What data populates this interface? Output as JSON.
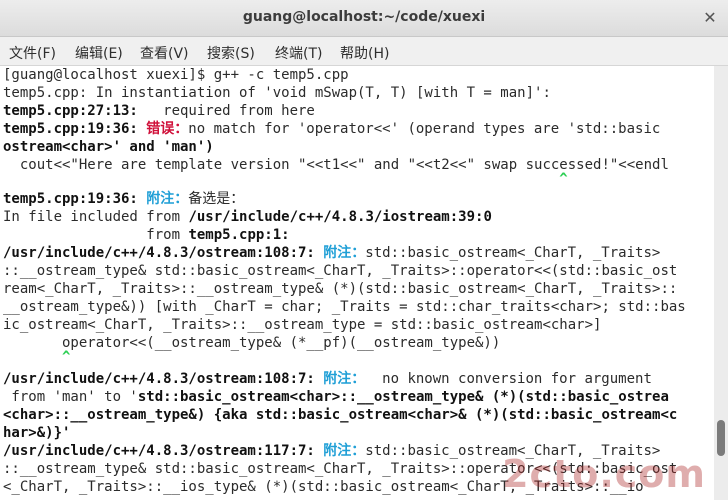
{
  "window": {
    "title": "guang@localhost:~/code/xuexi"
  },
  "menubar": {
    "items": [
      "文件(F)",
      "编辑(E)",
      "查看(V)",
      "搜索(S)",
      "终端(T)",
      "帮助(H)"
    ]
  },
  "terminal": {
    "prompt": "[guang@localhost xuexi]$ g++ -c temp5.cpp",
    "l2": "temp5.cpp: In instantiation of 'void mSwap(T, T) [with T = man]':",
    "l3a": "temp5.cpp:27:13:",
    "l3b": "   required from here",
    "l4a": "temp5.cpp:19:36: ",
    "l4err": "错误：",
    "l4b": "no match for 'operator<<' (operand types are 'std::basic",
    "l5": "ostream<char>' and 'man')",
    "l6": "  cout<<\"Here are template version \"<<t1<<\" and \"<<t2<<\" swap successed!\"<<endl",
    "l7": "                                                                  ^",
    "l8a": "temp5.cpp:19:36: ",
    "l8note": "附注：",
    "l8b": "备选是：",
    "l9a": "In file included from ",
    "l9b": "/usr/include/c++/4.8.3/iostream:39:0",
    "l10a": "                 from ",
    "l10b": "temp5.cpp:1:",
    "l11a": "/usr/include/c++/4.8.3/ostream:108:7: ",
    "l11note": "附注：",
    "l11b": "std::basic_ostream<_CharT, _Traits>",
    "l12": "::__ostream_type& std::basic_ostream<_CharT, _Traits>::operator<<(std::basic_ost",
    "l13": "ream<_CharT, _Traits>::__ostream_type& (*)(std::basic_ostream<_CharT, _Traits>::",
    "l14": "__ostream_type&)) [with _CharT = char; _Traits = std::char_traits<char>; std::bas",
    "l15": "ic_ostream<_CharT, _Traits>::__ostream_type = std::basic_ostream<char>]",
    "l16": "       operator<<(__ostream_type& (*__pf)(__ostream_type&))",
    "l17": "       ^",
    "l18a": "/usr/include/c++/4.8.3/ostream:108:7: ",
    "l18note": "附注：",
    "l18b": "  no known conversion for argument",
    "l19a": " from 'man' to '",
    "l19b": "std::basic_ostream<char>::__ostream_type& (*)(std::basic_ostrea",
    "l20": "<char>::__ostream_type&) {aka std::basic_ostream<char>& (*)(std::basic_ostream<c",
    "l21": "har>&)}'",
    "l22a": "/usr/include/c++/4.8.3/ostream:117:7: ",
    "l22note": "附注：",
    "l22b": "std::basic_ostream<_CharT, _Traits>",
    "l23": "::__ostream_type& std::basic_ostream<_CharT, _Traits>::operator<<(std::basic_ost",
    "l24": "<_CharT, _Traits>::__ios_type& (*)(std::basic_ostream<_CharT, _Traits>::__io"
  },
  "watermark": {
    "text": "2cto.com"
  }
}
